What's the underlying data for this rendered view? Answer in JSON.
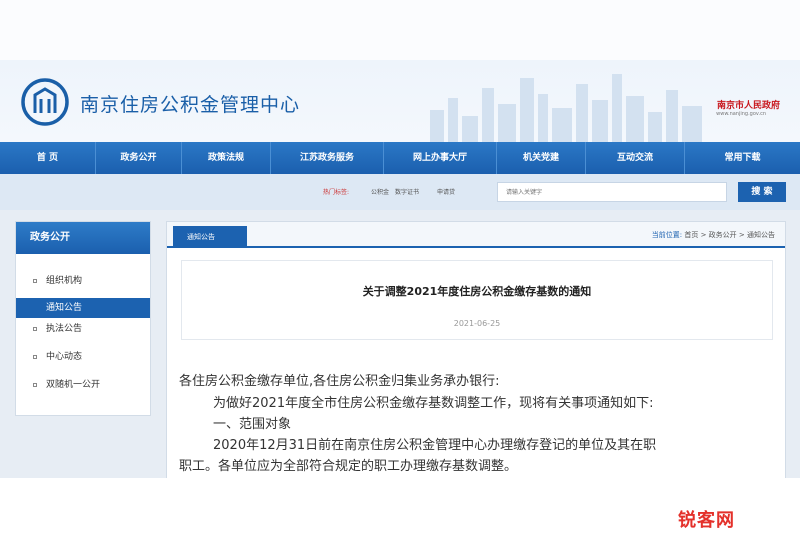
{
  "header": {
    "site_title": "南京住房公积金管理中心",
    "gov_title": "南京市人民政府",
    "gov_sub": "www.nanjing.gov.cn"
  },
  "nav": {
    "items": [
      "首 页",
      "政务公开",
      "政策法规",
      "江苏政务服务",
      "网上办事大厅",
      "机关党建",
      "互动交流",
      "常用下载"
    ]
  },
  "search": {
    "hot_label": "热门标签:",
    "hot_items": [
      "公积金",
      "数字证书",
      "申请贷"
    ],
    "placeholder": "请输入关键字",
    "button": "搜 索"
  },
  "sidebar": {
    "title": "政务公开",
    "items": [
      "组织机构",
      "通知公告",
      "执法公告",
      "中心动态",
      "双随机一公开"
    ],
    "active_index": 1
  },
  "main": {
    "tab": "通知公告",
    "breadcrumb_label": "当前位置:",
    "breadcrumb": "首页 > 政务公开 > 通知公告",
    "article_title": "关于调整2021年度住房公积金缴存基数的通知",
    "date": "2021-06-25",
    "body": [
      "各住房公积金缴存单位,各住房公积金归集业务承办银行:",
      "为做好2021年度全市住房公积金缴存基数调整工作，现将有关事项通知如下:",
      "一、范围对象",
      "2020年12月31日前在南京住房公积金管理中心办理缴存登记的单位及其在职",
      "职工。各单位应为全部符合规定的职工办理缴存基数调整。"
    ]
  },
  "watermark": "锐客网",
  "colors": {
    "brand_blue": "#1c62b0",
    "gov_red": "#c8161d",
    "watermark_red": "#e4312b"
  }
}
